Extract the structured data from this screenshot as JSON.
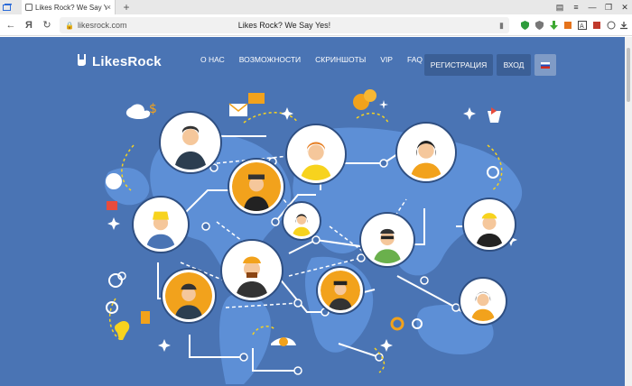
{
  "browser": {
    "tab_title": "Likes Rock? We Say Yes!",
    "url": "likesrock.com",
    "page_title": "Likes Rock? We Say Yes!",
    "new_tab": "+",
    "back": "←",
    "yandex": "Я",
    "reload": "↻",
    "close": "×"
  },
  "site": {
    "logo_text": "LikesRock",
    "nav": [
      "О НАС",
      "ВОЗМОЖНОСТИ",
      "СКРИНШОТЫ",
      "VIP",
      "FAQ"
    ],
    "register": "РЕГИСТРАЦИЯ",
    "login": "ВХОД"
  },
  "colors": {
    "page_bg": "#4a74b4",
    "map": "#5d8fd6",
    "accent_orange": "#f2a21c",
    "button_dark": "#3b5f96"
  }
}
